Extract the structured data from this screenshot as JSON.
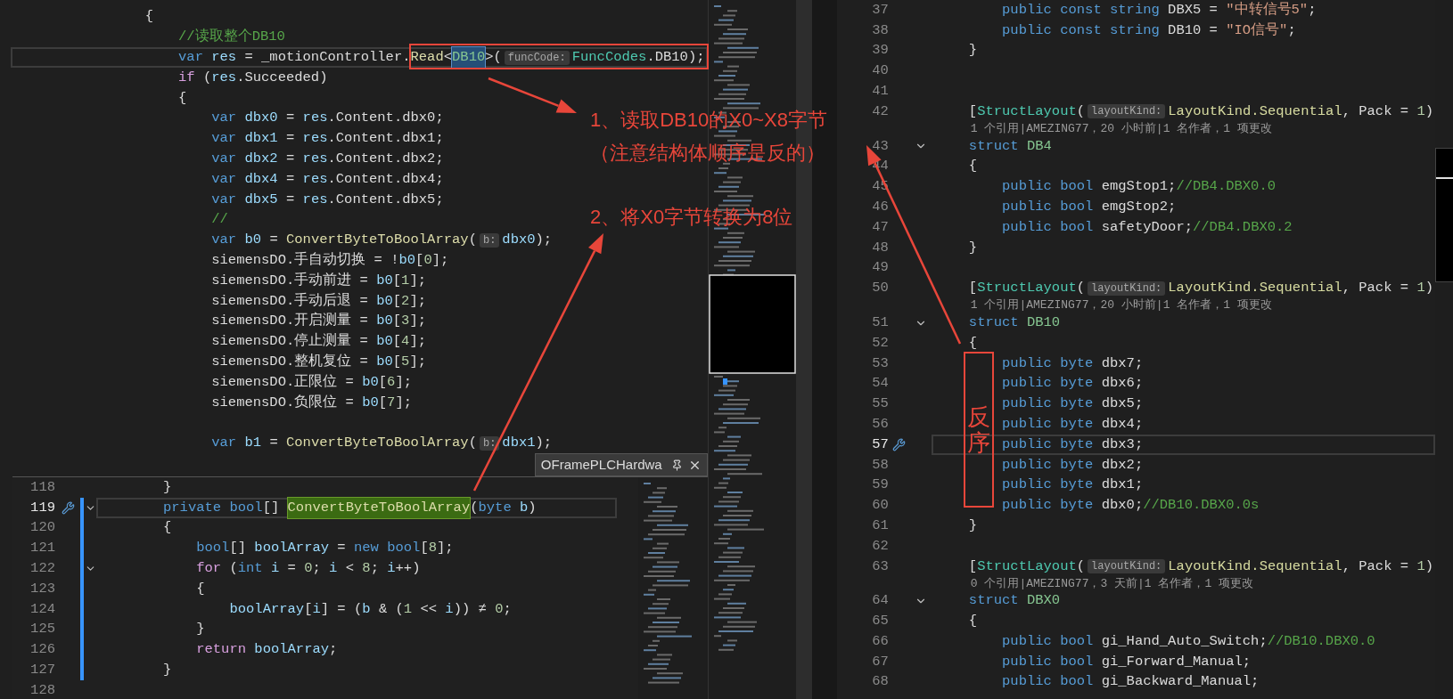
{
  "editor_top": {
    "lines": [
      {
        "current": false,
        "tokens": [
          {
            "kind": "plain",
            "text": "                {"
          }
        ]
      },
      {
        "current": false,
        "tokens": [
          {
            "kind": "comment",
            "text": "                    //读取整个DB10"
          }
        ]
      },
      {
        "current": true,
        "tokens": [
          {
            "kind": "kw",
            "text": "                    var "
          },
          {
            "kind": "local",
            "text": "res"
          },
          {
            "kind": "plain",
            "text": " = _motionController."
          },
          {
            "kind": "method",
            "text": "Read"
          },
          {
            "kind": "plain",
            "text": "<"
          },
          {
            "kind": "selected",
            "text": "DB10"
          },
          {
            "kind": "plain",
            "text": ">("
          },
          {
            "kind": "hint",
            "text": "funcCode:"
          },
          {
            "kind": "type",
            "text": "FuncCodes"
          },
          {
            "kind": "plain",
            "text": ".DB10);"
          }
        ]
      },
      {
        "current": false,
        "tokens": [
          {
            "kind": "ctl",
            "text": "                    if"
          },
          {
            "kind": "plain",
            "text": " ("
          },
          {
            "kind": "local",
            "text": "res"
          },
          {
            "kind": "plain",
            "text": ".Succeeded)"
          }
        ]
      },
      {
        "current": false,
        "tokens": [
          {
            "kind": "plain",
            "text": "                    {"
          }
        ]
      },
      {
        "current": false,
        "tokens": [
          {
            "kind": "kw",
            "text": "                        var "
          },
          {
            "kind": "local",
            "text": "dbx0"
          },
          {
            "kind": "plain",
            "text": " = "
          },
          {
            "kind": "local",
            "text": "res"
          },
          {
            "kind": "plain",
            "text": ".Content.dbx0;"
          }
        ]
      },
      {
        "current": false,
        "tokens": [
          {
            "kind": "kw",
            "text": "                        var "
          },
          {
            "kind": "local",
            "text": "dbx1"
          },
          {
            "kind": "plain",
            "text": " = "
          },
          {
            "kind": "local",
            "text": "res"
          },
          {
            "kind": "plain",
            "text": ".Content.dbx1;"
          }
        ]
      },
      {
        "current": false,
        "tokens": [
          {
            "kind": "kw",
            "text": "                        var "
          },
          {
            "kind": "local",
            "text": "dbx2"
          },
          {
            "kind": "plain",
            "text": " = "
          },
          {
            "kind": "local",
            "text": "res"
          },
          {
            "kind": "plain",
            "text": ".Content.dbx2;"
          }
        ]
      },
      {
        "current": false,
        "tokens": [
          {
            "kind": "kw",
            "text": "                        var "
          },
          {
            "kind": "local",
            "text": "dbx4"
          },
          {
            "kind": "plain",
            "text": " = "
          },
          {
            "kind": "local",
            "text": "res"
          },
          {
            "kind": "plain",
            "text": ".Content.dbx4;"
          }
        ]
      },
      {
        "current": false,
        "tokens": [
          {
            "kind": "kw",
            "text": "                        var "
          },
          {
            "kind": "local",
            "text": "dbx5"
          },
          {
            "kind": "plain",
            "text": " = "
          },
          {
            "kind": "local",
            "text": "res"
          },
          {
            "kind": "plain",
            "text": ".Content.dbx5;"
          }
        ]
      },
      {
        "current": false,
        "tokens": [
          {
            "kind": "comment",
            "text": "                        //"
          }
        ]
      },
      {
        "current": false,
        "tokens": [
          {
            "kind": "kw",
            "text": "                        var "
          },
          {
            "kind": "local",
            "text": "b0"
          },
          {
            "kind": "plain",
            "text": " = "
          },
          {
            "kind": "method",
            "text": "ConvertByteToBoolArray"
          },
          {
            "kind": "plain",
            "text": "("
          },
          {
            "kind": "hint",
            "text": "b:"
          },
          {
            "kind": "local",
            "text": "dbx0"
          },
          {
            "kind": "plain",
            "text": ");"
          }
        ]
      },
      {
        "current": false,
        "tokens": [
          {
            "kind": "plain",
            "text": "                        siemensDO.手自动切换 = !"
          },
          {
            "kind": "local",
            "text": "b0"
          },
          {
            "kind": "plain",
            "text": "["
          },
          {
            "kind": "num",
            "text": "0"
          },
          {
            "kind": "plain",
            "text": "];"
          }
        ]
      },
      {
        "current": false,
        "tokens": [
          {
            "kind": "plain",
            "text": "                        siemensDO.手动前进 = "
          },
          {
            "kind": "local",
            "text": "b0"
          },
          {
            "kind": "plain",
            "text": "["
          },
          {
            "kind": "num",
            "text": "1"
          },
          {
            "kind": "plain",
            "text": "];"
          }
        ]
      },
      {
        "current": false,
        "tokens": [
          {
            "kind": "plain",
            "text": "                        siemensDO.手动后退 = "
          },
          {
            "kind": "local",
            "text": "b0"
          },
          {
            "kind": "plain",
            "text": "["
          },
          {
            "kind": "num",
            "text": "2"
          },
          {
            "kind": "plain",
            "text": "];"
          }
        ]
      },
      {
        "current": false,
        "tokens": [
          {
            "kind": "plain",
            "text": "                        siemensDO.开启测量 = "
          },
          {
            "kind": "local",
            "text": "b0"
          },
          {
            "kind": "plain",
            "text": "["
          },
          {
            "kind": "num",
            "text": "3"
          },
          {
            "kind": "plain",
            "text": "];"
          }
        ]
      },
      {
        "current": false,
        "tokens": [
          {
            "kind": "plain",
            "text": "                        siemensDO.停止测量 = "
          },
          {
            "kind": "local",
            "text": "b0"
          },
          {
            "kind": "plain",
            "text": "["
          },
          {
            "kind": "num",
            "text": "4"
          },
          {
            "kind": "plain",
            "text": "];"
          }
        ]
      },
      {
        "current": false,
        "tokens": [
          {
            "kind": "plain",
            "text": "                        siemensDO.整机复位 = "
          },
          {
            "kind": "local",
            "text": "b0"
          },
          {
            "kind": "plain",
            "text": "["
          },
          {
            "kind": "num",
            "text": "5"
          },
          {
            "kind": "plain",
            "text": "];"
          }
        ]
      },
      {
        "current": false,
        "tokens": [
          {
            "kind": "plain",
            "text": "                        siemensDO.正限位 = "
          },
          {
            "kind": "local",
            "text": "b0"
          },
          {
            "kind": "plain",
            "text": "["
          },
          {
            "kind": "num",
            "text": "6"
          },
          {
            "kind": "plain",
            "text": "];"
          }
        ]
      },
      {
        "current": false,
        "tokens": [
          {
            "kind": "plain",
            "text": "                        siemensDO.负限位 = "
          },
          {
            "kind": "local",
            "text": "b0"
          },
          {
            "kind": "plain",
            "text": "["
          },
          {
            "kind": "num",
            "text": "7"
          },
          {
            "kind": "plain",
            "text": "];"
          }
        ]
      },
      {
        "current": false
      },
      {
        "current": false,
        "tokens": [
          {
            "kind": "kw",
            "text": "                        var "
          },
          {
            "kind": "local",
            "text": "b1"
          },
          {
            "kind": "plain",
            "text": " = "
          },
          {
            "kind": "method",
            "text": "ConvertByteToBoolArray"
          },
          {
            "kind": "plain",
            "text": "("
          },
          {
            "kind": "hint",
            "text": "b:"
          },
          {
            "kind": "local",
            "text": "dbx1"
          },
          {
            "kind": "plain",
            "text": ");"
          }
        ]
      }
    ]
  },
  "peek": {
    "title": "OFramePLCHardwa",
    "lines": [
      {
        "number": "118",
        "current": false,
        "changed": false,
        "fold": false,
        "tokens": [
          {
            "kind": "plain",
            "text": "}"
          }
        ]
      },
      {
        "number": "119",
        "current": true,
        "changed": true,
        "fold": true,
        "tokens": [
          {
            "kind": "kw",
            "text": "private "
          },
          {
            "kind": "kw",
            "text": "bool"
          },
          {
            "kind": "plain",
            "text": "[] "
          },
          {
            "kind": "highlight",
            "text": "ConvertByteToBoolArray"
          },
          {
            "kind": "plain",
            "text": "("
          },
          {
            "kind": "kw",
            "text": "byte "
          },
          {
            "kind": "local",
            "text": "b"
          },
          {
            "kind": "plain",
            "text": ")"
          }
        ]
      },
      {
        "number": "120",
        "current": false,
        "changed": true,
        "fold": false,
        "tokens": [
          {
            "kind": "plain",
            "text": "{"
          }
        ]
      },
      {
        "number": "121",
        "current": false,
        "changed": true,
        "fold": false,
        "tokens": [
          {
            "kind": "kw",
            "text": "    bool"
          },
          {
            "kind": "plain",
            "text": "[] "
          },
          {
            "kind": "local",
            "text": "boolArray"
          },
          {
            "kind": "plain",
            "text": " = "
          },
          {
            "kind": "kw",
            "text": "new "
          },
          {
            "kind": "kw",
            "text": "bool"
          },
          {
            "kind": "plain",
            "text": "["
          },
          {
            "kind": "num",
            "text": "8"
          },
          {
            "kind": "plain",
            "text": "];"
          }
        ]
      },
      {
        "number": "122",
        "current": false,
        "changed": true,
        "fold": true,
        "tokens": [
          {
            "kind": "ctl",
            "text": "    for"
          },
          {
            "kind": "plain",
            "text": " ("
          },
          {
            "kind": "kw",
            "text": "int "
          },
          {
            "kind": "local",
            "text": "i"
          },
          {
            "kind": "plain",
            "text": " = "
          },
          {
            "kind": "num",
            "text": "0"
          },
          {
            "kind": "plain",
            "text": "; "
          },
          {
            "kind": "local",
            "text": "i"
          },
          {
            "kind": "plain",
            "text": " < "
          },
          {
            "kind": "num",
            "text": "8"
          },
          {
            "kind": "plain",
            "text": "; "
          },
          {
            "kind": "local",
            "text": "i"
          },
          {
            "kind": "plain",
            "text": "++)"
          }
        ]
      },
      {
        "number": "123",
        "current": false,
        "changed": true,
        "fold": false,
        "tokens": [
          {
            "kind": "plain",
            "text": "    {"
          }
        ]
      },
      {
        "number": "124",
        "current": false,
        "changed": true,
        "fold": false,
        "tokens": [
          {
            "kind": "local",
            "text": "        boolArray"
          },
          {
            "kind": "plain",
            "text": "["
          },
          {
            "kind": "local",
            "text": "i"
          },
          {
            "kind": "plain",
            "text": "] = ("
          },
          {
            "kind": "local",
            "text": "b"
          },
          {
            "kind": "plain",
            "text": " & ("
          },
          {
            "kind": "num",
            "text": "1"
          },
          {
            "kind": "plain",
            "text": " << "
          },
          {
            "kind": "local",
            "text": "i"
          },
          {
            "kind": "plain",
            "text": ")) ≠ "
          },
          {
            "kind": "num",
            "text": "0"
          },
          {
            "kind": "plain",
            "text": ";"
          }
        ]
      },
      {
        "number": "125",
        "current": false,
        "changed": true,
        "fold": false,
        "tokens": [
          {
            "kind": "plain",
            "text": "    }"
          }
        ]
      },
      {
        "number": "126",
        "current": false,
        "changed": true,
        "fold": false,
        "tokens": [
          {
            "kind": "ctl",
            "text": "    return "
          },
          {
            "kind": "local",
            "text": "boolArray"
          },
          {
            "kind": "plain",
            "text": ";"
          }
        ]
      },
      {
        "number": "127",
        "current": false,
        "changed": true,
        "fold": false,
        "tokens": [
          {
            "kind": "plain",
            "text": "}"
          }
        ]
      },
      {
        "number": "128",
        "current": false,
        "changed": false,
        "fold": false
      }
    ]
  },
  "editor_right": {
    "lines": [
      {
        "kind": "code",
        "number": "37",
        "current": false,
        "fold": false,
        "tokens": [
          {
            "kind": "kw",
            "text": "    public const string "
          },
          {
            "kind": "plain",
            "text": "DBX5 = "
          },
          {
            "kind": "string",
            "text": "\"中转信号5\""
          },
          {
            "kind": "plain",
            "text": ";"
          }
        ]
      },
      {
        "kind": "code",
        "number": "38",
        "current": false,
        "fold": false,
        "tokens": [
          {
            "kind": "kw",
            "text": "    public const string "
          },
          {
            "kind": "plain",
            "text": "DB10 = "
          },
          {
            "kind": "string",
            "text": "\"IO信号\""
          },
          {
            "kind": "plain",
            "text": ";"
          }
        ]
      },
      {
        "kind": "code",
        "number": "39",
        "current": false,
        "fold": false,
        "tokens": [
          {
            "kind": "plain",
            "text": "}"
          }
        ]
      },
      {
        "kind": "code",
        "number": "40",
        "current": false,
        "fold": false
      },
      {
        "kind": "code",
        "number": "41",
        "current": false,
        "fold": false
      },
      {
        "kind": "code",
        "number": "42",
        "current": false,
        "fold": false,
        "tokens": [
          {
            "kind": "plain",
            "text": "["
          },
          {
            "kind": "type",
            "text": "StructLayout"
          },
          {
            "kind": "plain",
            "text": "("
          },
          {
            "kind": "hint",
            "text": "layoutKind:"
          },
          {
            "kind": "enumv",
            "text": "LayoutKind.Sequential"
          },
          {
            "kind": "plain",
            "text": ", Pack = "
          },
          {
            "kind": "num",
            "text": "1"
          },
          {
            "kind": "plain",
            "text": ")"
          }
        ]
      },
      {
        "kind": "codelens",
        "text": "1 个引用|AMEZING77，20 小时前|1 名作者，1 项更改"
      },
      {
        "kind": "code",
        "number": "43",
        "current": false,
        "fold": true,
        "tokens": [
          {
            "kind": "kw",
            "text": "struct "
          },
          {
            "kind": "struct",
            "text": "DB4"
          }
        ]
      },
      {
        "kind": "code",
        "number": "44",
        "current": false,
        "fold": false,
        "tokens": [
          {
            "kind": "plain",
            "text": "{"
          }
        ]
      },
      {
        "kind": "code",
        "number": "45",
        "current": false,
        "fold": false,
        "tokens": [
          {
            "kind": "kw",
            "text": "    public bool "
          },
          {
            "kind": "plain",
            "text": "emgStop1;"
          },
          {
            "kind": "comment",
            "text": "//DB4.DBX0.0"
          }
        ]
      },
      {
        "kind": "code",
        "number": "46",
        "current": false,
        "fold": false,
        "tokens": [
          {
            "kind": "kw",
            "text": "    public bool "
          },
          {
            "kind": "plain",
            "text": "emgStop2;"
          }
        ]
      },
      {
        "kind": "code",
        "number": "47",
        "current": false,
        "fold": false,
        "tokens": [
          {
            "kind": "kw",
            "text": "    public bool "
          },
          {
            "kind": "plain",
            "text": "safetyDoor;"
          },
          {
            "kind": "comment",
            "text": "//DB4.DBX0.2"
          }
        ]
      },
      {
        "kind": "code",
        "number": "48",
        "current": false,
        "fold": false,
        "tokens": [
          {
            "kind": "plain",
            "text": "}"
          }
        ]
      },
      {
        "kind": "code",
        "number": "49",
        "current": false,
        "fold": false
      },
      {
        "kind": "code",
        "number": "50",
        "current": false,
        "fold": false,
        "tokens": [
          {
            "kind": "plain",
            "text": "["
          },
          {
            "kind": "type",
            "text": "StructLayout"
          },
          {
            "kind": "plain",
            "text": "("
          },
          {
            "kind": "hint",
            "text": "layoutKind:"
          },
          {
            "kind": "enumv",
            "text": "LayoutKind.Sequential"
          },
          {
            "kind": "plain",
            "text": ", Pack = "
          },
          {
            "kind": "num",
            "text": "1"
          },
          {
            "kind": "plain",
            "text": ")"
          }
        ]
      },
      {
        "kind": "codelens",
        "text": "1 个引用|AMEZING77，20 小时前|1 名作者，1 项更改"
      },
      {
        "kind": "code",
        "number": "51",
        "current": false,
        "fold": true,
        "tokens": [
          {
            "kind": "kw",
            "text": "struct "
          },
          {
            "kind": "struct",
            "text": "DB10"
          }
        ]
      },
      {
        "kind": "code",
        "number": "52",
        "current": false,
        "fold": false,
        "tokens": [
          {
            "kind": "plain",
            "text": "{"
          }
        ]
      },
      {
        "kind": "code",
        "number": "53",
        "current": false,
        "fold": false,
        "tokens": [
          {
            "kind": "kw",
            "text": "    public byte "
          },
          {
            "kind": "plain",
            "text": "dbx7;"
          }
        ]
      },
      {
        "kind": "code",
        "number": "54",
        "current": false,
        "fold": false,
        "tokens": [
          {
            "kind": "kw",
            "text": "    public byte "
          },
          {
            "kind": "plain",
            "text": "dbx6;"
          }
        ]
      },
      {
        "kind": "code",
        "number": "55",
        "current": false,
        "fold": false,
        "tokens": [
          {
            "kind": "kw",
            "text": "    public byte "
          },
          {
            "kind": "plain",
            "text": "dbx5;"
          }
        ]
      },
      {
        "kind": "code",
        "number": "56",
        "current": false,
        "fold": false,
        "tokens": [
          {
            "kind": "kw",
            "text": "    public byte "
          },
          {
            "kind": "plain",
            "text": "dbx4;"
          }
        ]
      },
      {
        "kind": "code",
        "number": "57",
        "current": true,
        "fold": false,
        "tokens": [
          {
            "kind": "kw",
            "text": "    public byte "
          },
          {
            "kind": "plain",
            "text": "dbx3;"
          }
        ]
      },
      {
        "kind": "code",
        "number": "58",
        "current": false,
        "fold": false,
        "tokens": [
          {
            "kind": "kw",
            "text": "    public byte "
          },
          {
            "kind": "plain",
            "text": "dbx2;"
          }
        ]
      },
      {
        "kind": "code",
        "number": "59",
        "current": false,
        "fold": false,
        "tokens": [
          {
            "kind": "kw",
            "text": "    public byte "
          },
          {
            "kind": "plain",
            "text": "dbx1;"
          }
        ]
      },
      {
        "kind": "code",
        "number": "60",
        "current": false,
        "fold": false,
        "tokens": [
          {
            "kind": "kw",
            "text": "    public byte "
          },
          {
            "kind": "plain",
            "text": "dbx0;"
          },
          {
            "kind": "comment",
            "text": "//DB10.DBX0.0s"
          }
        ]
      },
      {
        "kind": "code",
        "number": "61",
        "current": false,
        "fold": false,
        "tokens": [
          {
            "kind": "plain",
            "text": "}"
          }
        ]
      },
      {
        "kind": "code",
        "number": "62",
        "current": false,
        "fold": false
      },
      {
        "kind": "code",
        "number": "63",
        "current": false,
        "fold": false,
        "tokens": [
          {
            "kind": "plain",
            "text": "["
          },
          {
            "kind": "type",
            "text": "StructLayout"
          },
          {
            "kind": "plain",
            "text": "("
          },
          {
            "kind": "hint",
            "text": "layoutKind:"
          },
          {
            "kind": "enumv",
            "text": "LayoutKind.Sequential"
          },
          {
            "kind": "plain",
            "text": ", Pack = "
          },
          {
            "kind": "num",
            "text": "1"
          },
          {
            "kind": "plain",
            "text": ")"
          }
        ]
      },
      {
        "kind": "codelens",
        "text": "0 个引用|AMEZING77，3 天前|1 名作者，1 项更改"
      },
      {
        "kind": "code",
        "number": "64",
        "current": false,
        "fold": true,
        "tokens": [
          {
            "kind": "kw",
            "text": "struct "
          },
          {
            "kind": "struct",
            "text": "DBX0"
          }
        ]
      },
      {
        "kind": "code",
        "number": "65",
        "current": false,
        "fold": false,
        "tokens": [
          {
            "kind": "plain",
            "text": "{"
          }
        ]
      },
      {
        "kind": "code",
        "number": "66",
        "current": false,
        "fold": false,
        "tokens": [
          {
            "kind": "kw",
            "text": "    public bool "
          },
          {
            "kind": "plain",
            "text": "gi_Hand_Auto_Switch;"
          },
          {
            "kind": "comment",
            "text": "//DB10.DBX0.0"
          }
        ]
      },
      {
        "kind": "code",
        "number": "67",
        "current": false,
        "fold": false,
        "tokens": [
          {
            "kind": "kw",
            "text": "    public bool "
          },
          {
            "kind": "plain",
            "text": "gi_Forward_Manual;"
          }
        ]
      },
      {
        "kind": "code",
        "number": "68",
        "current": false,
        "fold": false,
        "tokens": [
          {
            "kind": "kw",
            "text": "    public bool "
          },
          {
            "kind": "plain",
            "text": "gi_Backward_Manual;"
          }
        ]
      }
    ]
  },
  "annotations": {
    "notes": [
      "1、读取DB10的X0~X8字节",
      "（注意结构体顺序是反的）",
      "2、将X0字节转换为8位"
    ],
    "reverse_label": "反序"
  }
}
